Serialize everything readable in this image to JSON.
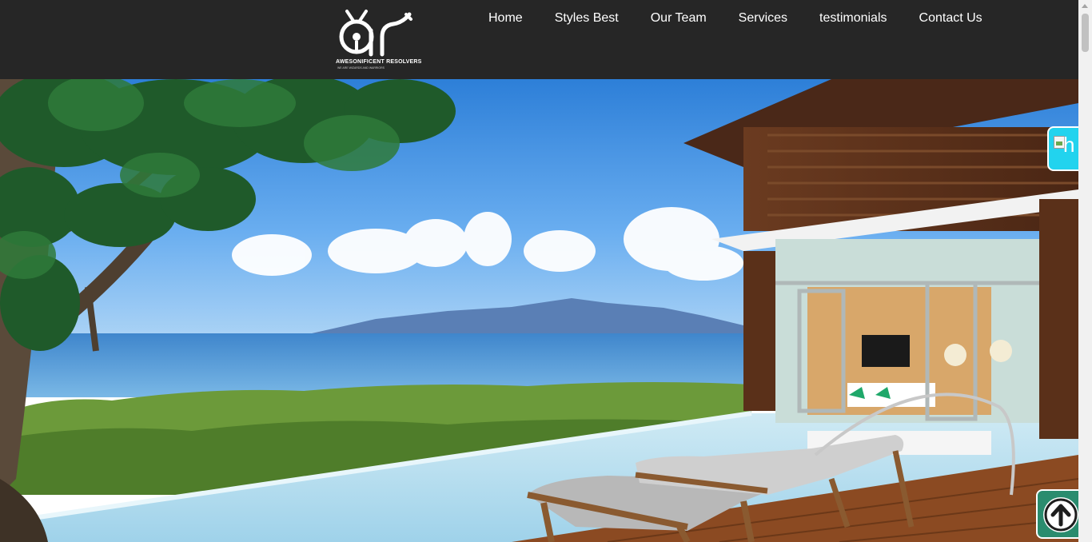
{
  "header": {
    "logo": {
      "monogram": "ar",
      "name": "AWESONIFICENT RESOLVERS",
      "tagline": "WE ARE WIZARDS AND WARRIORS"
    },
    "nav": [
      {
        "label": "Home"
      },
      {
        "label": "Styles Best"
      },
      {
        "label": "Our Team"
      },
      {
        "label": "Services"
      },
      {
        "label": "testimonials"
      },
      {
        "label": "Contact Us"
      }
    ]
  },
  "hero": {
    "image": "beach-villa-pool-photo"
  },
  "floating_widget": {
    "alt_text": "h",
    "icon": "broken-image-icon"
  },
  "scroll_top": {
    "icon": "arrow-up-icon"
  },
  "colors": {
    "header_bg": "#262626",
    "nav_text": "#ffffff",
    "widget_bg": "#22d3ee",
    "scroll_top_bg": "#2a8c6e"
  }
}
